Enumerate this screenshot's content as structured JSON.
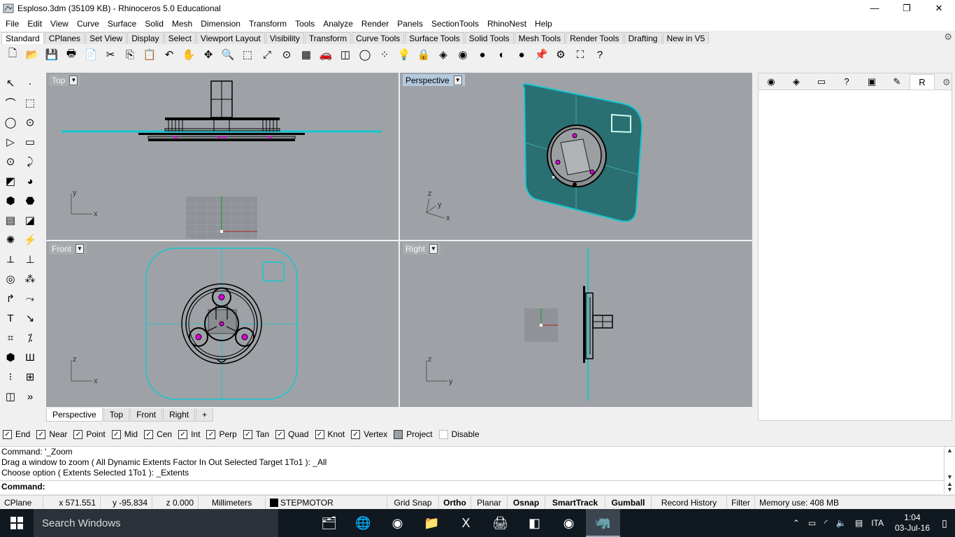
{
  "window": {
    "title": "Esploso.3dm (35109 KB) - Rhinoceros 5.0 Educational",
    "minimize": "—",
    "restore": "❐",
    "close": "✕"
  },
  "menu": [
    "File",
    "Edit",
    "View",
    "Curve",
    "Surface",
    "Solid",
    "Mesh",
    "Dimension",
    "Transform",
    "Tools",
    "Analyze",
    "Render",
    "Panels",
    "SectionTools",
    "RhinoNest",
    "Help"
  ],
  "toolbar_tabs": [
    "Standard",
    "CPlanes",
    "Set View",
    "Display",
    "Select",
    "Viewport Layout",
    "Visibility",
    "Transform",
    "Curve Tools",
    "Surface Tools",
    "Solid Tools",
    "Mesh Tools",
    "Render Tools",
    "Drafting",
    "New in V5"
  ],
  "toolbar_icons": [
    "new-file-icon",
    "open-icon",
    "save-icon",
    "print-icon",
    "import-icon",
    "cut-icon",
    "copy-icon",
    "paste-icon",
    "undo-icon",
    "pan-icon",
    "rotate-view-icon",
    "zoom-icon",
    "zoom-window-icon",
    "zoom-extents-icon",
    "zoom-selected-icon",
    "grid-icon",
    "car-icon",
    "cplane-icon",
    "circle-icon",
    "points-icon",
    "bulb-icon",
    "lock-icon",
    "layer-icon",
    "color-wheel-icon",
    "sphere-icon",
    "render-sphere-icon",
    "blue-sphere-icon",
    "pin-icon",
    "gear-icon",
    "options-icon",
    "help-icon"
  ],
  "toolbar_glyphs": [
    "🗋",
    "📂",
    "💾",
    "🖶",
    "📄",
    "✂",
    "⎘",
    "📋",
    "↶",
    "✋",
    "✥",
    "🔍",
    "⬚",
    "⤢",
    "⊙",
    "▦",
    "🚗",
    "◫",
    "◯",
    "⁘",
    "💡",
    "🔒",
    "◈",
    "◉",
    "●",
    "◐",
    "●",
    "📌",
    "⚙",
    "⛶",
    "?"
  ],
  "left_tools": [
    "↖",
    "·",
    "⌒",
    "⬚",
    "◯",
    "⊙",
    "▷",
    "▭",
    "⊙",
    "⤸",
    "◩",
    "◕",
    "⬢",
    "⬣",
    "▤",
    "◪",
    "✺",
    "⚡",
    "⟂",
    "⊥",
    "◎",
    "⁂",
    "↱",
    "⤳",
    "T",
    "↘",
    "⌗",
    "⁒",
    "⬢",
    "Ш",
    "⁝",
    "⊞",
    "◫",
    "»"
  ],
  "viewports": {
    "top": {
      "label": "Top",
      "axis_x": "x",
      "axis_y": "y"
    },
    "perspective": {
      "label": "Perspective",
      "axis_x": "x",
      "axis_y": "y",
      "axis_z": "z"
    },
    "front": {
      "label": "Front",
      "axis_x": "x",
      "axis_y": "z"
    },
    "right": {
      "label": "Right",
      "axis_x": "y",
      "axis_y": "z"
    }
  },
  "viewport_tabs": [
    "Perspective",
    "Top",
    "Front",
    "Right",
    "+"
  ],
  "panel_tab_icons": [
    "properties-icon",
    "layers-icon",
    "display-icon",
    "help-icon",
    "materials-icon",
    "drafting-icon",
    "rhino-icon"
  ],
  "panel_tab_glyphs": [
    "◉",
    "◈",
    "▭",
    "?",
    "▣",
    "✎",
    "R"
  ],
  "osnaps": [
    {
      "label": "End",
      "checked": true
    },
    {
      "label": "Near",
      "checked": true
    },
    {
      "label": "Point",
      "checked": true
    },
    {
      "label": "Mid",
      "checked": true
    },
    {
      "label": "Cen",
      "checked": true
    },
    {
      "label": "Int",
      "checked": true
    },
    {
      "label": "Perp",
      "checked": true
    },
    {
      "label": "Tan",
      "checked": true
    },
    {
      "label": "Quad",
      "checked": true
    },
    {
      "label": "Knot",
      "checked": true
    },
    {
      "label": "Vertex",
      "checked": true
    },
    {
      "label": "Project",
      "checked": false
    },
    {
      "label": "Disable",
      "checked": false
    }
  ],
  "command_history": [
    "Command: '_Zoom",
    "Drag a window to zoom ( All  Dynamic  Extents  Factor  In  Out  Selected  Target  1To1 ): _All",
    "Choose option ( Extents  Selected  1To1 ): _Extents"
  ],
  "command_prompt": "Command:",
  "status": {
    "cplane": "CPlane",
    "x": "x 571.551",
    "y": "y -95.834",
    "z": "z 0.000",
    "units": "Millimeters",
    "layer": "STEPMOTOR",
    "grid_snap": "Grid Snap",
    "ortho": "Ortho",
    "planar": "Planar",
    "osnap": "Osnap",
    "smarttrack": "SmartTrack",
    "gumball": "Gumball",
    "record_history": "Record History",
    "filter": "Filter",
    "memory": "Memory use: 408 MB"
  },
  "taskbar": {
    "search": "Search Windows",
    "apps": [
      "file-explorer-icon",
      "network-icon",
      "chrome-icon",
      "folder-icon",
      "excel-icon",
      "scanner-icon",
      "app-icon",
      "chrome-icon",
      "rhino-icon"
    ],
    "app_glyphs": [
      "🗂",
      "🌐",
      "◉",
      "📁",
      "X",
      "🖨",
      "◧",
      "◉",
      "🦏"
    ],
    "language": "ITA",
    "time": "1:04",
    "date": "03-Jul-16"
  },
  "colors": {
    "viewport_bg": "#9ea2a7",
    "cyan": "#16c6d0",
    "magenta": "#e000e0",
    "persp_surface": "#2a6f72"
  }
}
